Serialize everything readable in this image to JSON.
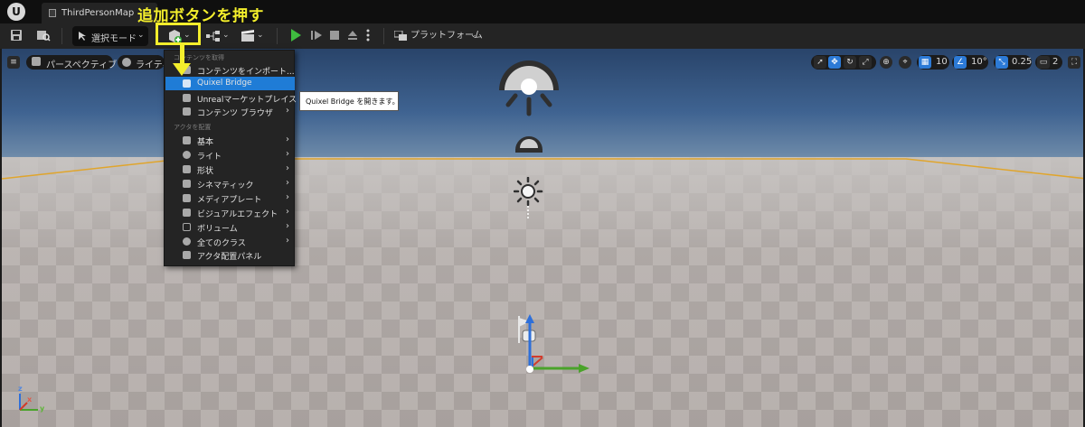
{
  "annotation": {
    "text": "追加ボタンを押す"
  },
  "titlebar": {
    "logo": "U",
    "tab_label": "ThirdPersonMap"
  },
  "toolbar": {
    "save_icon": "save-icon",
    "browse_icon": "folder-browse-icon",
    "mode_label": "選択モード",
    "platform_label": "プラットフォーム"
  },
  "viewport": {
    "perspective_label": "パースペクティブ",
    "lighting_label": "ライティ",
    "grid_snap_value": "10",
    "rotation_snap_value": "10°",
    "scale_snap_value": "0.25",
    "camera_speed_value": "2"
  },
  "menu": {
    "section_content": "コンテンツを取得",
    "section_place": "アクタを配置",
    "items": [
      {
        "label": "コンテンツをインポート...",
        "submenu": false
      },
      {
        "label": "Quixel Bridge",
        "submenu": false,
        "highlighted": true
      },
      {
        "label": "Unrealマーケットプレイス",
        "submenu": false
      },
      {
        "label": "コンテンツ ブラウザ",
        "submenu": true
      },
      {
        "label": "基本",
        "submenu": true
      },
      {
        "label": "ライト",
        "submenu": true
      },
      {
        "label": "形状",
        "submenu": true
      },
      {
        "label": "シネマティック",
        "submenu": true
      },
      {
        "label": "メディアプレート",
        "submenu": true
      },
      {
        "label": "ビジュアルエフェクト",
        "submenu": true
      },
      {
        "label": "ボリューム",
        "submenu": true
      },
      {
        "label": "全てのクラス",
        "submenu": true
      },
      {
        "label": "アクタ配置パネル",
        "submenu": false
      }
    ],
    "submenu_arrow": "›"
  },
  "tooltip": {
    "text": "Quixel Bridge を開きます。"
  },
  "axes": {
    "x": "x",
    "y": "y",
    "z": "z"
  },
  "colors": {
    "annotation": "#f3ee2c",
    "highlight": "#1f7cd6",
    "play": "#3fbb3f"
  }
}
